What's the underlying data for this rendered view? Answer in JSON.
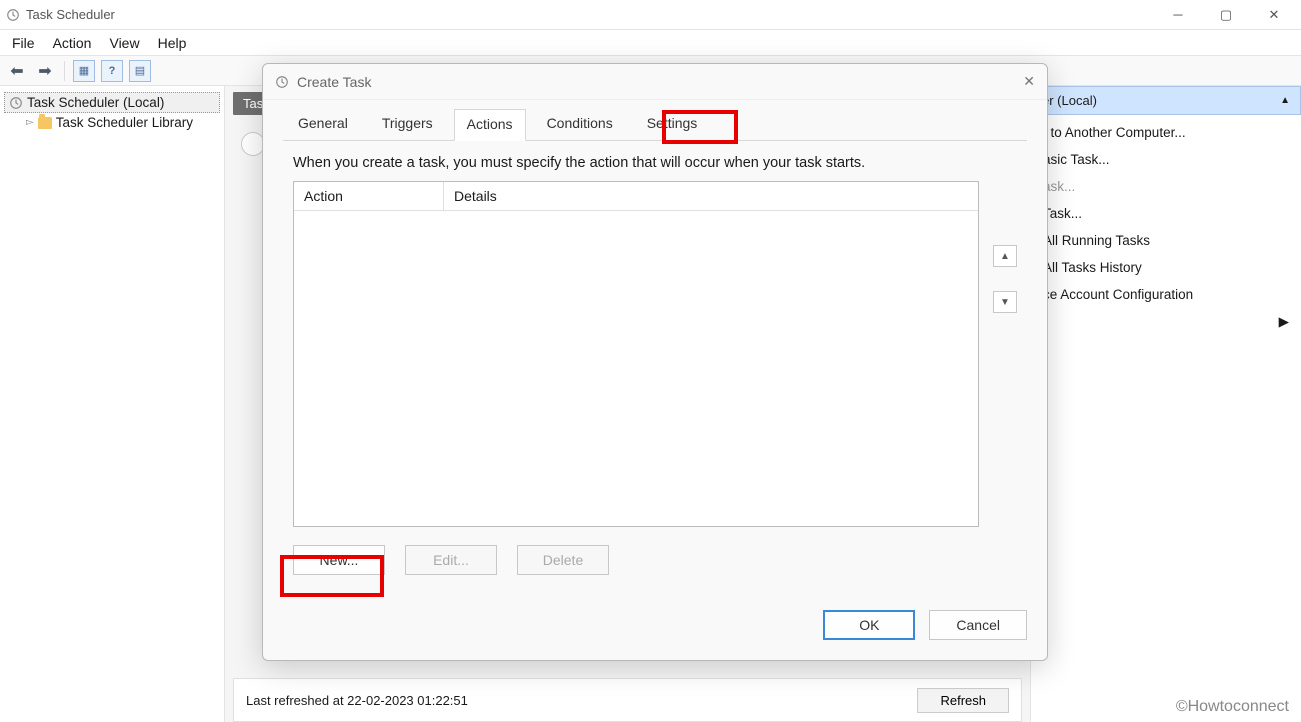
{
  "app": {
    "title": "Task Scheduler"
  },
  "menubar": {
    "file": "File",
    "action": "Action",
    "view": "View",
    "help": "Help"
  },
  "tree": {
    "root": "Task Scheduler (Local)",
    "child": "Task Scheduler Library"
  },
  "center": {
    "chip": "Task",
    "status": "Last refreshed at 22-02-2023 01:22:51",
    "refresh": "Refresh"
  },
  "rightpane": {
    "header": "er (Local)",
    "items": [
      "t to Another Computer...",
      "asic Task...",
      "ask...",
      "Task...",
      "All Running Tasks",
      "All Tasks History",
      "ce Account Configuration"
    ]
  },
  "dialog": {
    "title": "Create Task",
    "tabs": {
      "general": "General",
      "triggers": "Triggers",
      "actions": "Actions",
      "conditions": "Conditions",
      "settings": "Settings"
    },
    "hint": "When you create a task, you must specify the action that will occur when your task starts.",
    "cols": {
      "action": "Action",
      "details": "Details"
    },
    "buttons": {
      "new": "New...",
      "edit": "Edit...",
      "delete": "Delete",
      "ok": "OK",
      "cancel": "Cancel"
    }
  },
  "watermark": "©Howtoconnect"
}
